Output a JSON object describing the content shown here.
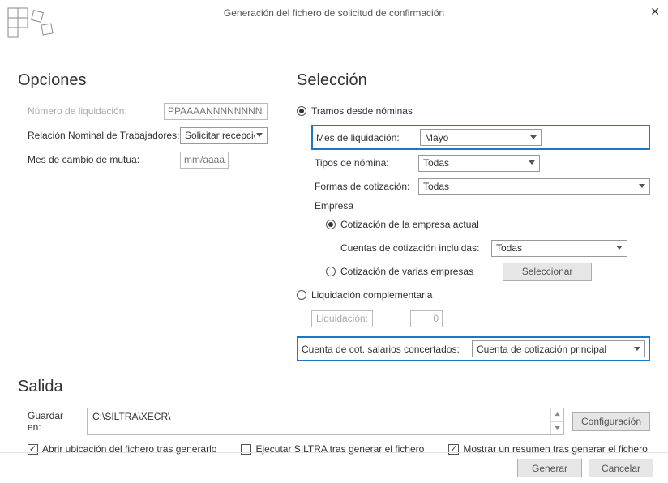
{
  "title": "Generación del fichero de solicitud de confirmación",
  "opciones": {
    "heading": "Opciones",
    "num_liq_label": "Número de liquidación:",
    "num_liq_placeholder": "PPAAAANNNNNNNNNDC",
    "relacion_label": "Relación Nominal de Trabajadores:",
    "relacion_value": "Solicitar recepció",
    "mes_cambio_label": "Mes de cambio de mutua:",
    "mes_cambio_placeholder": "mm/aaaa"
  },
  "seleccion": {
    "heading": "Selección",
    "rb_tramos": "Tramos desde nóminas",
    "mes_liq_label": "Mes de liquidación:",
    "mes_liq_value": "Mayo",
    "tipos_label": "Tipos de nómina:",
    "tipos_value": "Todas",
    "formas_label": "Formas de cotización:",
    "formas_value": "Todas",
    "empresa_label": "Empresa",
    "rb_cot_actual": "Cotización de la empresa actual",
    "cuentas_incl_label": "Cuentas de cotización incluidas:",
    "cuentas_incl_value": "Todas",
    "rb_cot_varias": "Cotización de varias empresas",
    "seleccionar_btn": "Seleccionar",
    "rb_liq_compl": "Liquidación complementaria",
    "liquidacion_label": "Liquidación:",
    "liquidacion_value": "0",
    "cuenta_cot_label": "Cuenta de cot. salarios concertados:",
    "cuenta_cot_value": "Cuenta de cotización principal"
  },
  "salida": {
    "heading": "Salida",
    "guardar_label": "Guardar en:",
    "path": "C:\\SILTRA\\XECR\\",
    "config_btn": "Configuración",
    "chk_abrir": "Abrir ubicación del fichero tras generarlo",
    "chk_ejecutar": "Ejecutar SILTRA tras generar el fichero",
    "chk_resumen": "Mostrar un resumen tras generar el fichero"
  },
  "footer": {
    "generar": "Generar",
    "cancelar": "Cancelar"
  }
}
